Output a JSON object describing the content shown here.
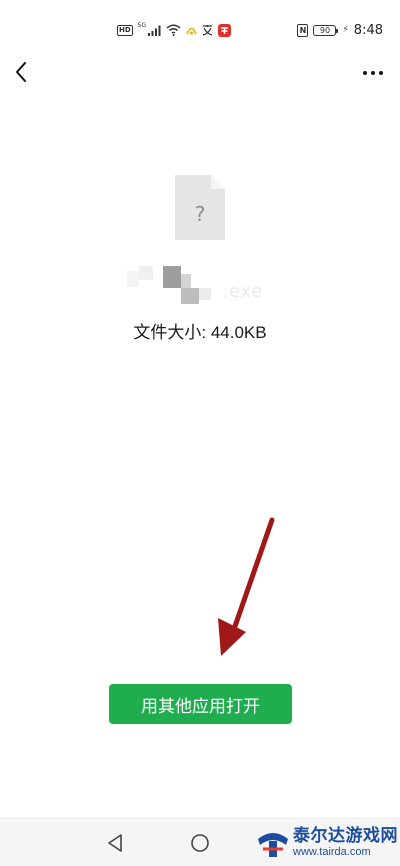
{
  "status_bar": {
    "hd": "HD",
    "network": "5G",
    "battery": "90",
    "time": "8:48",
    "nfc": "N",
    "bolt": "⚡"
  },
  "top_bar": {
    "back_icon": "chevron-left",
    "more_icon": "ellipsis"
  },
  "file": {
    "icon_glyph": "?",
    "name_visible": ".exe",
    "size_label": "文件大小: 44.0KB"
  },
  "actions": {
    "open_with_label": "用其他应用打开"
  },
  "watermark": {
    "title": "泰尔达游戏网",
    "url": "www.tairda.com"
  },
  "colors": {
    "button_green": "#1fad4f",
    "arrow_red": "#a01818",
    "watermark_blue": "#1d4d9c"
  }
}
